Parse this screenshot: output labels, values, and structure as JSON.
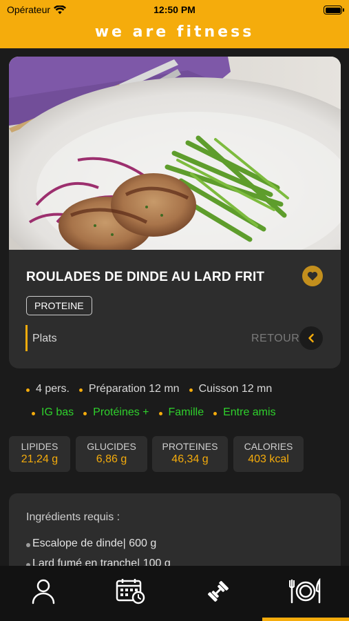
{
  "status": {
    "carrier": "Opérateur",
    "time": "12:50 PM"
  },
  "header": {
    "brand": "we are fitness"
  },
  "recipe": {
    "title": "ROULADES DE DINDE AU LARD FRIT",
    "tag": "PROTEINE",
    "category": "Plats",
    "back_label": "RETOUR"
  },
  "info_line1": [
    "4 pers.",
    "Préparation 12 mn",
    "Cuisson 12 mn"
  ],
  "info_line2": [
    "IG bas",
    "Protéines +",
    "Famille",
    "Entre amis"
  ],
  "nutrition": [
    {
      "label": "LIPIDES",
      "value": "21,24 g"
    },
    {
      "label": "GLUCIDES",
      "value": "6,86 g"
    },
    {
      "label": "PROTEINES",
      "value": "46,34 g"
    },
    {
      "label": "CALORIES",
      "value": "403 kcal"
    }
  ],
  "ingredients": {
    "heading": "Ingrédients requis :",
    "items": [
      "Escalope de dinde| 600 g",
      "Lard fumé en tranche| 100 g"
    ]
  },
  "tabs": [
    {
      "icon": "profile-icon"
    },
    {
      "icon": "calendar-clock-icon"
    },
    {
      "icon": "dumbbell-icon"
    },
    {
      "icon": "plate-cutlery-icon",
      "active": true
    }
  ],
  "colors": {
    "accent": "#f5ac0c",
    "green": "#2fd12c",
    "card": "#2d2d2d",
    "background": "#1b1b1b"
  }
}
